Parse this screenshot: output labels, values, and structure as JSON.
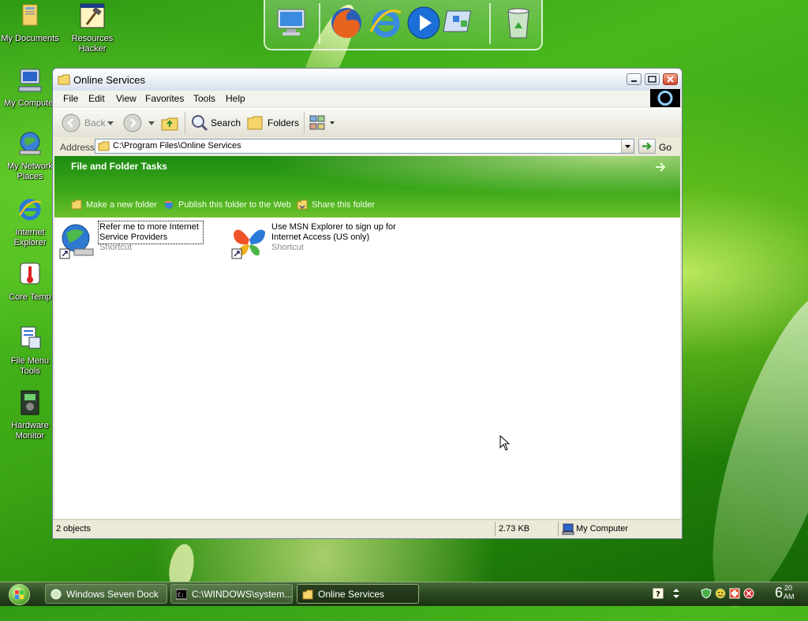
{
  "desktop": {
    "icons": [
      {
        "label": "My Documents",
        "icon": "folder-documents-icon"
      },
      {
        "label": "Resources Hacker",
        "icon": "hammer-app-icon"
      },
      {
        "label": "My Computer",
        "icon": "computer-icon"
      },
      {
        "label": "My Network Places",
        "icon": "network-globe-icon"
      },
      {
        "label": "Internet Explorer",
        "icon": "internet-explorer-icon"
      },
      {
        "label": "Core Temp",
        "icon": "thermometer-icon"
      },
      {
        "label": "File Menu Tools",
        "icon": "file-tools-icon"
      },
      {
        "label": "Hardware Monitor",
        "icon": "hardware-monitor-icon"
      }
    ]
  },
  "dock": {
    "items": [
      {
        "name": "My Computer",
        "icon": "monitor-icon"
      },
      {
        "name": "Firefox",
        "icon": "firefox-icon"
      },
      {
        "name": "Internet Explorer",
        "icon": "internet-explorer-icon"
      },
      {
        "name": "Media Player",
        "icon": "play-icon"
      },
      {
        "name": "Control Panel",
        "icon": "control-panel-icon"
      },
      {
        "name": "Recycle Bin",
        "icon": "recycle-bin-icon"
      }
    ]
  },
  "window": {
    "title": "Online Services",
    "menu": [
      "File",
      "Edit",
      "View",
      "Favorites",
      "Tools",
      "Help"
    ],
    "toolbar": {
      "back": "Back",
      "search": "Search",
      "folders": "Folders"
    },
    "address": {
      "label": "Address",
      "value": "C:\\Program Files\\Online Services",
      "go": "Go"
    },
    "tasks": {
      "title": "File and Folder Tasks",
      "links": [
        "Make a new folder",
        "Publish this folder to the Web",
        "Share this folder"
      ]
    },
    "files": [
      {
        "name": "Refer me to more Internet Service Providers",
        "type": "Shortcut",
        "icon": "globe-shortcut-icon"
      },
      {
        "name": "Use MSN Explorer to sign up for Internet Access (US only)",
        "type": "Shortcut",
        "icon": "msn-butterfly-icon"
      }
    ],
    "status": {
      "objects": "2 objects",
      "size": "2.73 KB",
      "location": "My Computer"
    }
  },
  "taskbar": {
    "buttons": [
      {
        "label": "Windows Seven Dock",
        "active": false
      },
      {
        "label": "C:\\WINDOWS\\system...",
        "active": false
      },
      {
        "label": "Online Services",
        "active": true
      }
    ],
    "clock": {
      "time": "6",
      "minutes": "20",
      "ampm": "AM"
    }
  },
  "colors": {
    "window_frame": "#ece9d8",
    "taskpane_green": "#3ba81a",
    "desktop_green": "#3aa414"
  }
}
